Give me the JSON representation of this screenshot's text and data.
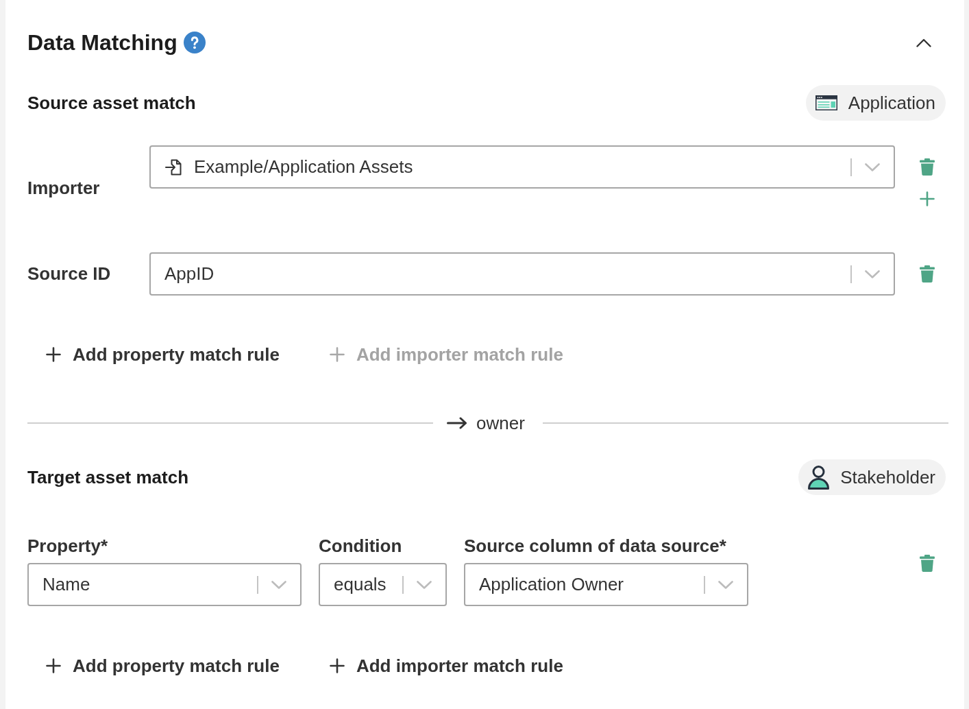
{
  "panel": {
    "title": "Data Matching",
    "expanded": true
  },
  "source_match": {
    "title": "Source asset match",
    "asset_type": {
      "kind": "application",
      "label": "Application"
    },
    "rules": [
      {
        "kind": "importer",
        "label": "Importer",
        "value": "Example/Application Assets"
      },
      {
        "kind": "property",
        "label": "Source ID",
        "value": "AppID"
      }
    ],
    "actions": [
      {
        "label": "Add property match rule",
        "disabled": false
      },
      {
        "label": "Add importer match rule",
        "disabled": true
      }
    ]
  },
  "relation": {
    "label": "owner"
  },
  "target_match": {
    "title": "Target asset match",
    "asset_type": {
      "kind": "stakeholder",
      "label": "Stakeholder"
    },
    "fields": [
      {
        "label": "Property*",
        "value": "Name"
      },
      {
        "label": "Condition",
        "value": "equals"
      },
      {
        "label": "Source column of data source*",
        "value": "Application Owner"
      }
    ],
    "actions": [
      {
        "label": "Add property match rule",
        "disabled": false
      },
      {
        "label": "Add importer match rule",
        "disabled": false
      }
    ]
  }
}
